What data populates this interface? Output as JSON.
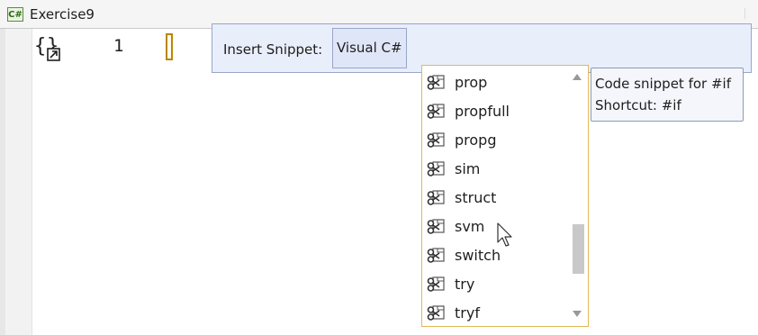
{
  "file_tab": {
    "icon": "csharp-file-icon",
    "icon_text": "C#",
    "name": "Exercise9"
  },
  "editor": {
    "line_number": "1",
    "snippet_glyph_icon": "snippet-insert-icon"
  },
  "snippet_bar": {
    "label": "Insert Snippet:",
    "path_chip": "Visual C#"
  },
  "completion_list": {
    "item_icon": "snippet-scissors-icon",
    "items": [
      {
        "label": "prop"
      },
      {
        "label": "propfull"
      },
      {
        "label": "propg"
      },
      {
        "label": "sim"
      },
      {
        "label": "struct"
      },
      {
        "label": "svm"
      },
      {
        "label": "switch"
      },
      {
        "label": "try"
      },
      {
        "label": "tryf"
      }
    ],
    "scroll_position_fraction": 0.72
  },
  "tooltip": {
    "line1": "Code snippet for #if",
    "line2": "Shortcut: #if"
  },
  "colors": {
    "snippet_bar_bg": "#e9eefb",
    "list_border": "#e3b75a",
    "caret_box": "#b8860b"
  }
}
